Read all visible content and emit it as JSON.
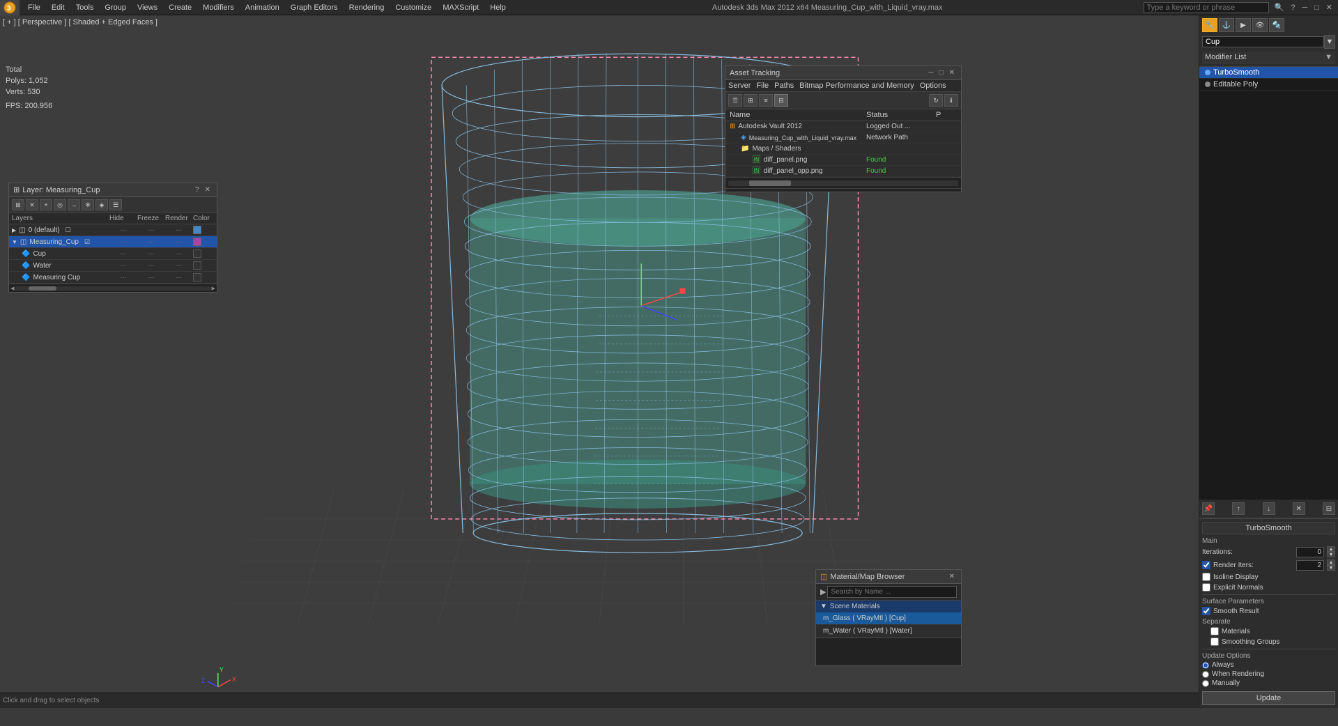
{
  "app": {
    "title": "Autodesk 3ds Max 2012 x64",
    "filename": "Measuring_Cup_with_Liquid_vray.max",
    "full_title": "Autodesk 3ds Max 2012 x64    Measuring_Cup_with_Liquid_vray.max"
  },
  "menu": {
    "items": [
      "File",
      "Edit",
      "Tools",
      "Group",
      "Views",
      "Create",
      "Modifiers",
      "Animation",
      "Graph Editors",
      "Rendering",
      "Customize",
      "MAXScript",
      "Help"
    ]
  },
  "search_placeholder": "Type a keyword or phrase",
  "viewport": {
    "label": "[ + ] [ Perspective ] [ Shaded + Edged Faces ]",
    "stats": {
      "polys_label": "Polys:",
      "polys_value": "1,052",
      "verts_label": "Verts:",
      "verts_value": "530",
      "fps_label": "FPS:",
      "fps_value": "200.956",
      "total_label": "Total"
    }
  },
  "layer_manager": {
    "title": "Layer: Measuring_Cup",
    "columns": [
      "Layers",
      "Hide",
      "Freeze",
      "Render",
      "Color"
    ],
    "layers": [
      {
        "id": 0,
        "name": "0 (default)",
        "hide": "---",
        "freeze": "---",
        "render": "---",
        "color": "blue",
        "indent": 0
      },
      {
        "id": 1,
        "name": "Measuring_Cup",
        "hide": "---",
        "freeze": "---",
        "render": "---",
        "color": "purple",
        "indent": 0,
        "active": true
      },
      {
        "id": 2,
        "name": "Cup",
        "hide": "---",
        "freeze": "---",
        "render": "---",
        "color": "dark",
        "indent": 1
      },
      {
        "id": 3,
        "name": "Water",
        "hide": "---",
        "freeze": "---",
        "render": "---",
        "color": "dark",
        "indent": 1
      },
      {
        "id": 4,
        "name": "Measuring Cup",
        "hide": "---",
        "freeze": "---",
        "render": "---",
        "color": "dark",
        "indent": 1
      }
    ]
  },
  "asset_tracking": {
    "title": "Asset Tracking",
    "menu_items": [
      "Server",
      "File",
      "Paths",
      "Bitmap Performance and Memory",
      "Options"
    ],
    "columns": [
      "Name",
      "Status",
      "P"
    ],
    "assets": [
      {
        "name": "Autodesk Vault 2012",
        "status": "Logged Out ...",
        "type": "vault",
        "indent": 0
      },
      {
        "name": "Measuring_Cup_with_Liquid_vray.max",
        "status": "Network Path",
        "type": "max",
        "indent": 1
      },
      {
        "name": "Maps / Shaders",
        "status": "",
        "type": "folder",
        "indent": 1
      },
      {
        "name": "diff_panel.png",
        "status": "Found",
        "type": "image",
        "indent": 2
      },
      {
        "name": "diff_panel_opp.png",
        "status": "Found",
        "type": "image",
        "indent": 2
      }
    ]
  },
  "right_panel": {
    "object_name": "Cup",
    "modifier_list_title": "Modifier List",
    "modifiers": [
      {
        "name": "TurboSmooth",
        "active": true
      },
      {
        "name": "Editable Poly",
        "active": false
      }
    ],
    "turbosm": {
      "title": "TurboSmooth",
      "main_label": "Main",
      "iterations_label": "Iterations:",
      "iterations_value": "0",
      "render_iters_label": "Render Iters:",
      "render_iters_value": "2",
      "isoline_display_label": "Isoline Display",
      "explicit_normals_label": "Explicit Normals",
      "surface_params_label": "Surface Parameters",
      "smooth_result_label": "Smooth Result",
      "smooth_result_checked": true,
      "separate_label": "Separate",
      "materials_label": "Materials",
      "smoothing_groups_label": "Smoothing Groups",
      "update_options_label": "Update Options",
      "always_label": "Always",
      "when_rendering_label": "When Rendering",
      "manually_label": "Manually",
      "update_btn_label": "Update"
    }
  },
  "material_browser": {
    "title": "Material/Map Browser",
    "search_placeholder": "Search by Name ...",
    "scene_materials_label": "Scene Materials",
    "materials": [
      {
        "name": "m_Glass ( VRayMtl ) [Cup]",
        "selected": true
      },
      {
        "name": "m_Water ( VRayMtl ) [Water]",
        "selected": false
      }
    ]
  },
  "bottom_bar": {
    "hint": "Click and drag to select objects"
  }
}
